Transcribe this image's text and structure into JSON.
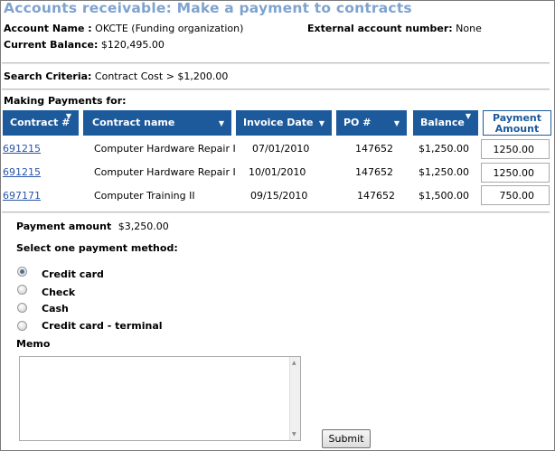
{
  "page": {
    "title": "Accounts receivable: Make a payment to contracts"
  },
  "account": {
    "name_label": "Account Name :",
    "name_value": "OKCTE (Funding organization)",
    "external_label": "External account number:",
    "external_value": "None",
    "balance_label": "Current Balance:",
    "balance_value": "$120,495.00"
  },
  "search": {
    "label": "Search Criteria:",
    "value": "Contract Cost > $1,200.00"
  },
  "payments_heading": "Making Payments for:",
  "table": {
    "headers": {
      "contract": "Contract #",
      "contract_name": "Contract name",
      "invoice_date": "Invoice Date",
      "po": "PO #",
      "balance": "Balance",
      "payment_amount_line1": "Payment",
      "payment_amount_line2": "Amount"
    },
    "rows": [
      {
        "contract": "691215",
        "contract_name": "Computer Hardware Repair I",
        "invoice_date": "07/01/2010",
        "po": "147652",
        "balance": "$1,250.00",
        "payment": "1250.00"
      },
      {
        "contract": "691215",
        "contract_name": "Computer Hardware Repair I",
        "invoice_date": "10/01/2010",
        "po": "147652",
        "balance": "$1,250.00",
        "payment": "1250.00"
      },
      {
        "contract": "697171",
        "contract_name": "Computer Training II",
        "invoice_date": "09/15/2010",
        "po": "147652",
        "balance": "$1,500.00",
        "payment": "750.00"
      }
    ]
  },
  "payment": {
    "amount_label": "Payment amount",
    "amount_value": "$3,250.00",
    "method_prompt": "Select one payment method:",
    "methods": [
      {
        "label": "Credit card",
        "selected": true
      },
      {
        "label": "Check",
        "selected": false
      },
      {
        "label": "Cash",
        "selected": false
      },
      {
        "label": "Credit card - terminal",
        "selected": false
      }
    ]
  },
  "memo": {
    "label": "Memo",
    "value": ""
  },
  "submit_label": "Submit",
  "icons": {
    "sort": "sort-down-icon"
  },
  "colors": {
    "title": "#7fa3cf",
    "header_bg": "#1c5a9c",
    "link": "#2a55a8"
  }
}
